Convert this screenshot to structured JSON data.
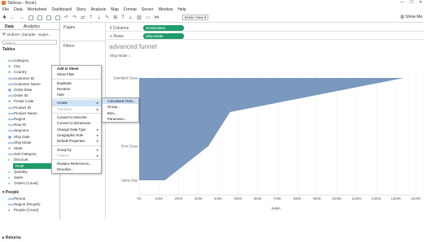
{
  "window": {
    "title": "Tableau - Book1",
    "controls": [
      "—",
      "☐",
      "✕"
    ]
  },
  "menubar": [
    "File",
    "Data",
    "Worksheet",
    "Dashboard",
    "Story",
    "Analysis",
    "Map",
    "Format",
    "Server",
    "Window",
    "Help"
  ],
  "toolbar": {
    "view_select": "Entire View",
    "show_me": "Show Me"
  },
  "left_pane": {
    "tabs": [
      "Data",
      "Analytics"
    ],
    "datasource": "Orders+ (Sample - Super...",
    "search_placeholder": "Search",
    "tables_heading": "Tables",
    "fields": [
      {
        "name": "Category",
        "type": "dim"
      },
      {
        "name": "City",
        "type": "geo"
      },
      {
        "name": "Country",
        "type": "geo"
      },
      {
        "name": "Customer ID",
        "type": "dim"
      },
      {
        "name": "Customer Name",
        "type": "dim"
      },
      {
        "name": "Order Date",
        "type": "date"
      },
      {
        "name": "Order ID",
        "type": "dim"
      },
      {
        "name": "Postal Code",
        "type": "geo"
      },
      {
        "name": "Product ID",
        "type": "dim"
      },
      {
        "name": "Product Name",
        "type": "dim"
      },
      {
        "name": "Region",
        "type": "dim"
      },
      {
        "name": "Row ID",
        "type": "dim"
      },
      {
        "name": "Segment",
        "type": "dim"
      },
      {
        "name": "Ship Date",
        "type": "date"
      },
      {
        "name": "Ship Mode",
        "type": "dim"
      },
      {
        "name": "State",
        "type": "geo"
      },
      {
        "name": "Sub-Category",
        "type": "dim"
      },
      {
        "name": "Discount",
        "type": "measure"
      },
      {
        "name": "Profit",
        "type": "measure"
      },
      {
        "name": "Quantity",
        "type": "measure"
      },
      {
        "name": "Sales",
        "type": "measure"
      },
      {
        "name": "Orders (Count)",
        "type": "measure"
      }
    ],
    "people_heading": "People",
    "people_fields": [
      "Person",
      "Region (People)",
      "People (Count)"
    ],
    "returns_heading": "Returns"
  },
  "pages_label": "Pages",
  "filters_label": "Filters",
  "shelves": {
    "columns_label": "Columns",
    "columns_pill": "SUM(Sales)",
    "rows_label": "Rows",
    "rows_pill": "Ship Mode"
  },
  "viz": {
    "title": "advanced funnel",
    "column_header": "Ship Mode ="
  },
  "context_menu": {
    "items": [
      {
        "label": "Add to Sheet",
        "bold": true
      },
      {
        "label": "Show Filter"
      },
      {
        "sep": true
      },
      {
        "label": "Duplicate"
      },
      {
        "label": "Rename"
      },
      {
        "label": "Hide"
      },
      {
        "sep": true
      },
      {
        "label": "Create",
        "submenu": true,
        "selected": true
      },
      {
        "label": "Transform",
        "submenu": true,
        "disabled": true
      },
      {
        "sep": true
      },
      {
        "label": "Convert to Discrete"
      },
      {
        "label": "Convert to Dimension"
      },
      {
        "label": "Change Data Type",
        "submenu": true
      },
      {
        "label": "Geographic Role",
        "submenu": true
      },
      {
        "label": "Default Properties",
        "submenu": true
      },
      {
        "sep": true
      },
      {
        "label": "Group by",
        "submenu": true
      },
      {
        "label": "Folders",
        "submenu": true,
        "disabled": true
      },
      {
        "sep": true
      },
      {
        "label": "Replace References..."
      },
      {
        "label": "Describe..."
      }
    ],
    "submenu": [
      "Calculated Field...",
      "Group...",
      "Bins...",
      "Parameter..."
    ]
  },
  "chart_data": {
    "type": "area",
    "title": "advanced funnel",
    "xlabel": "Sales",
    "ylabel": "Ship Mode",
    "categories": [
      "Standard Class",
      "Second Class",
      "First Class",
      "Same Day"
    ],
    "values": [
      1340000,
      460000,
      350000,
      130000
    ],
    "x_ticks": [
      "0K",
      "100K",
      "200K",
      "300K",
      "400K",
      "500K",
      "600K",
      "700K",
      "800K",
      "900K",
      "1000K",
      "1100K",
      "1200K",
      "1300K",
      "1400K"
    ],
    "xlim": [
      0,
      1400000
    ],
    "colors": {
      "fill": "#7b99bf"
    }
  }
}
